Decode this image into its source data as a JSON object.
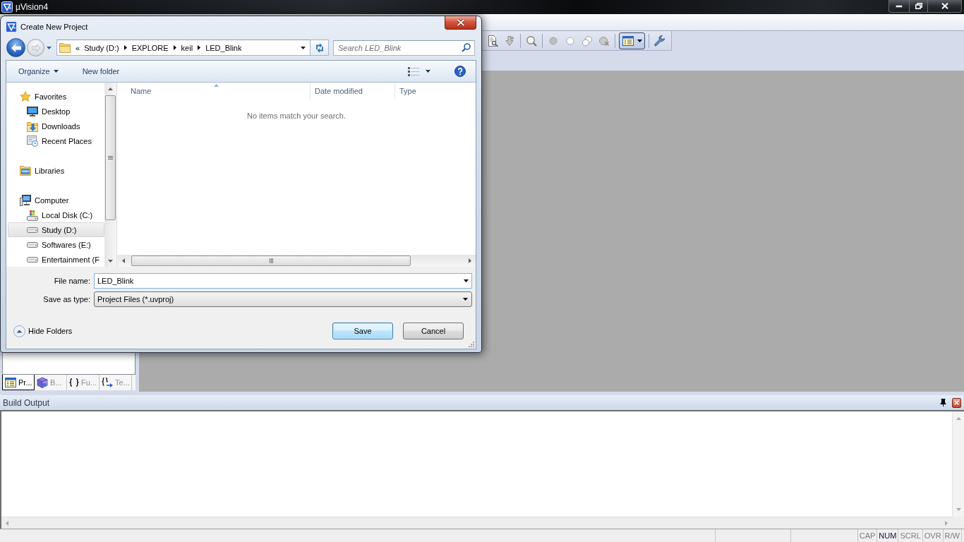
{
  "window": {
    "title": "µVision4"
  },
  "toolbar": {
    "layout_button": {
      "pressed": true
    }
  },
  "dialog": {
    "title": "Create New Project",
    "address": {
      "overflow": "«",
      "crumbs": [
        "Study (D:)",
        "EXPLORE",
        "keil",
        "LED_Blink"
      ]
    },
    "search": {
      "placeholder": "Search LED_Blink"
    },
    "commands": [
      {
        "label": "Organize",
        "dropdown": true
      },
      {
        "label": "New folder",
        "dropdown": false
      }
    ],
    "nav": [
      {
        "label": "Favorites",
        "kind": "favorites",
        "selected": false,
        "children": [
          {
            "label": "Desktop",
            "kind": "desktop",
            "selected": false
          },
          {
            "label": "Downloads",
            "kind": "downloads",
            "selected": false
          },
          {
            "label": "Recent Places",
            "kind": "recent",
            "selected": false
          }
        ]
      },
      {
        "label": "Libraries",
        "kind": "libraries",
        "selected": false
      },
      {
        "label": "Computer",
        "kind": "computer",
        "selected": false,
        "children": [
          {
            "label": "Local Disk (C:)",
            "kind": "system-drive",
            "selected": false
          },
          {
            "label": "Study (D:)",
            "kind": "drive",
            "selected": true
          },
          {
            "label": "Softwares (E:)",
            "kind": "drive",
            "selected": false
          },
          {
            "label": "Entertainment (F",
            "kind": "drive",
            "selected": false
          }
        ]
      }
    ],
    "columns": [
      {
        "label": "Name",
        "sorted": true
      },
      {
        "label": "Date modified",
        "sorted": false
      },
      {
        "label": "Type",
        "sorted": false
      }
    ],
    "empty_message": "No items match your search.",
    "file_name": {
      "label": "File name:",
      "value": "LED_Blink"
    },
    "save_as_type": {
      "label": "Save as type:",
      "value": "Project Files (*.uvproj)"
    },
    "hide_folders": "Hide Folders",
    "buttons": [
      {
        "label": "Save",
        "default": true
      },
      {
        "label": "Cancel",
        "default": false
      }
    ]
  },
  "project_tabs": [
    {
      "label": "Pr...",
      "kind": "project",
      "selected": true
    },
    {
      "label": "B...",
      "kind": "books",
      "selected": false
    },
    {
      "label": "Fu...",
      "kind": "functions",
      "selected": false
    },
    {
      "label": "Te...",
      "kind": "templates",
      "selected": false
    }
  ],
  "build_output": {
    "title": "Build Output"
  },
  "status_bar": {
    "indicators": [
      {
        "label": "CAP",
        "on": false
      },
      {
        "label": "NUM",
        "on": true
      },
      {
        "label": "SCRL",
        "on": false
      },
      {
        "label": "OVR",
        "on": false
      },
      {
        "label": "R/W",
        "on": false
      }
    ]
  }
}
